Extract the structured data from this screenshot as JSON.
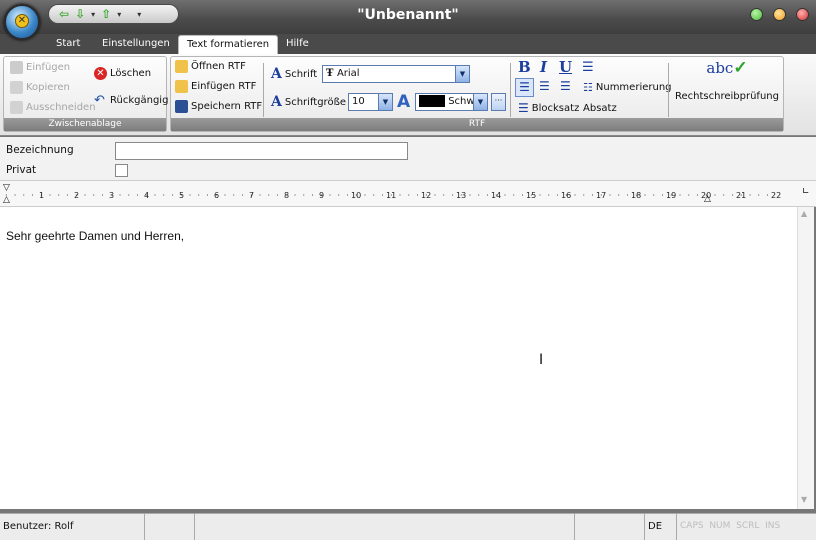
{
  "window": {
    "title": "\"Unbenannt\"",
    "btn_colors": [
      "#4dbb3a",
      "#f0a020",
      "#d83030"
    ]
  },
  "qat": {
    "back": "⇦",
    "down": "⇩",
    "up": "⇧",
    "menu": "▾"
  },
  "tabs": [
    "Start",
    "Einstellungen",
    "Text formatieren",
    "Hilfe"
  ],
  "ribbon": {
    "clipboard": {
      "label": "Zwischenablage",
      "paste": "Einfügen",
      "copy": "Kopieren",
      "cut": "Ausschneiden",
      "delete": "Löschen",
      "undo": "Rückgängig"
    },
    "rtf": {
      "label": "RTF",
      "open": "Öffnen RTF",
      "insert": "Einfügen RTF",
      "save": "Speichern RTF",
      "font_label": "Schrift",
      "font_value": "Arial",
      "size_label": "Schriftgröße",
      "size_value": "10",
      "color_value": "Schwa",
      "bold": "B",
      "italic": "I",
      "underline": "U",
      "justify": "Blocksatz",
      "paragraph": "Absatz",
      "numbering": "Nummerierung",
      "spellcheck": "Rechtschreibprüfung",
      "spell_icon": "abc"
    }
  },
  "form": {
    "label_name": "Bezeichnung",
    "name_value": "",
    "label_private": "Privat",
    "private_checked": false
  },
  "ruler": {
    "numbers": [
      "1",
      "2",
      "3",
      "4",
      "5",
      "6",
      "7",
      "8",
      "9",
      "10",
      "11",
      "12",
      "13",
      "14",
      "15",
      "16",
      "17",
      "18",
      "19",
      "20",
      "21",
      "22"
    ]
  },
  "document": {
    "text": "Sehr geehrte Damen und Herren,"
  },
  "status": {
    "user": "Benutzer: Rolf",
    "lang": "DE",
    "caps": "CAPS",
    "num": "NUM",
    "scrl": "SCRL",
    "ins": "INS"
  }
}
